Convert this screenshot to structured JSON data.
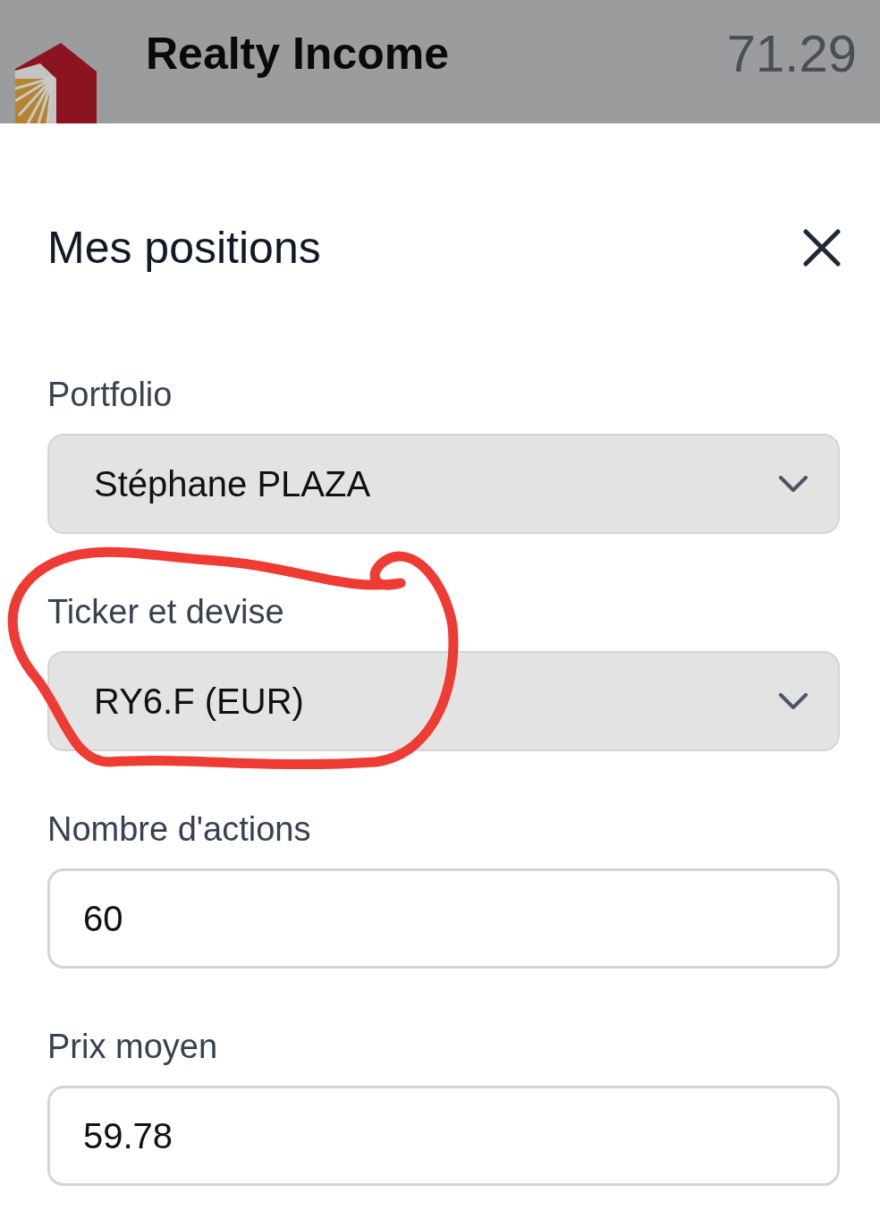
{
  "header": {
    "company": "Realty Income",
    "price": "71.29"
  },
  "sheet": {
    "title": "Mes positions",
    "fields": [
      {
        "kind": "select",
        "label": "Portfolio",
        "value": "Stéphane PLAZA"
      },
      {
        "kind": "select",
        "label": "Ticker et devise",
        "value": "RY6.F (EUR)"
      },
      {
        "kind": "input",
        "label": "Nombre d'actions",
        "value": "60"
      },
      {
        "kind": "input",
        "label": "Prix moyen",
        "value": "59.78"
      }
    ]
  }
}
